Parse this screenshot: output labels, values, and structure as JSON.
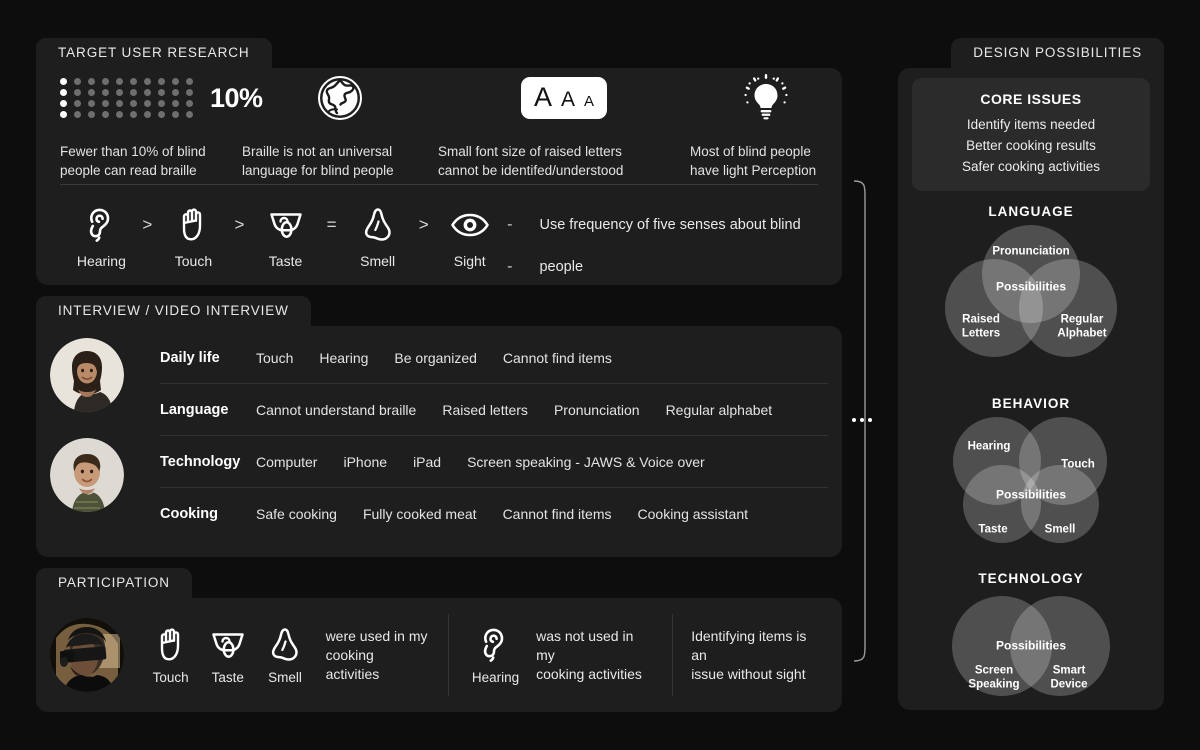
{
  "background_color": "#0d0d0d",
  "panel_color": "#1e1e1e",
  "left": {
    "research": {
      "tab_label": "TARGET USER RESEARCH",
      "stat": {
        "percent_label": "10%",
        "dot_columns": 10,
        "dot_rows": 4,
        "highlighted_columns": 1
      },
      "facts": [
        {
          "icon": "braille-dot-grid-icon",
          "text": "Fewer than 10% of blind\npeople can read braille"
        },
        {
          "icon": "globe-icon",
          "text": "Braille is not an universal\nlanguage for blind people"
        },
        {
          "icon": "font-size-icon",
          "text": "Small font size of raised letters\ncannot be identifed/understood"
        },
        {
          "icon": "lightbulb-icon",
          "text": "Most of blind people\nhave light Perception"
        }
      ],
      "aaa_badge": {
        "large": "A",
        "medium": "A",
        "small": "A"
      },
      "senses": [
        {
          "icon": "ear-icon",
          "label": "Hearing"
        },
        {
          "op": ">"
        },
        {
          "icon": "hand-icon",
          "label": "Touch"
        },
        {
          "op": ">"
        },
        {
          "icon": "tongue-icon",
          "label": "Taste"
        },
        {
          "op": "="
        },
        {
          "icon": "nose-icon",
          "label": "Smell"
        },
        {
          "op": ">"
        },
        {
          "icon": "eye-icon",
          "label": "Sight"
        }
      ],
      "senses_dashes": "--",
      "senses_note": "Use frequency of five senses about blind people"
    },
    "interview": {
      "tab_label": "INTERVIEW / VIDEO INTERVIEW",
      "avatars": [
        "interviewee-woman-photo",
        "interviewee-man-photo"
      ],
      "rows": [
        {
          "category": "Daily life",
          "tags": [
            "Touch",
            "Hearing",
            "Be organized",
            "Cannot find items"
          ]
        },
        {
          "category": "Language",
          "tags": [
            "Cannot understand braille",
            "Raised letters",
            "Pronunciation",
            "Regular alphabet"
          ]
        },
        {
          "category": "Technology",
          "tags": [
            "Computer",
            "iPhone",
            "iPad",
            "Screen speaking - JAWS & Voice over"
          ]
        },
        {
          "category": "Cooking",
          "tags": [
            "Safe cooking",
            "Fully cooked meat",
            "Cannot find items",
            "Cooking assistant"
          ]
        }
      ]
    },
    "participation": {
      "tab_label": "PARTICIPATION",
      "avatar": "blindfolded-participant-photo",
      "groups": [
        {
          "senses": [
            {
              "icon": "hand-icon",
              "label": "Touch"
            },
            {
              "icon": "tongue-icon",
              "label": "Taste"
            },
            {
              "icon": "nose-icon",
              "label": "Smell"
            }
          ],
          "text": "were used in my\ncooking activities"
        },
        {
          "senses": [
            {
              "icon": "ear-icon",
              "label": "Hearing"
            }
          ],
          "text": "was not used in my\ncooking activities"
        },
        {
          "senses": [],
          "text": "Identifying items is an\nissue without sight"
        }
      ]
    }
  },
  "right": {
    "tab_label": "DESIGN POSSIBILITIES",
    "core_issues": {
      "title": "CORE ISSUES",
      "items": [
        "Identify items needed",
        "Better cooking results",
        "Safer cooking activities"
      ]
    },
    "venns": [
      {
        "title": "LANGUAGE",
        "circles": 3,
        "center_label": "Possibilities",
        "labels": [
          "Pronunciation",
          "Raised\nLetters",
          "Regular\nAlphabet"
        ]
      },
      {
        "title": "BEHAVIOR",
        "circles": 4,
        "center_label": "Possibilities",
        "labels": [
          "Hearing",
          "Touch",
          "Taste",
          "Smell"
        ]
      },
      {
        "title": "TECHNOLOGY",
        "circles": 2,
        "center_label": "Possibilities",
        "labels": [
          "Screen\nSpeaking",
          "Smart\nDevice"
        ]
      }
    ]
  }
}
